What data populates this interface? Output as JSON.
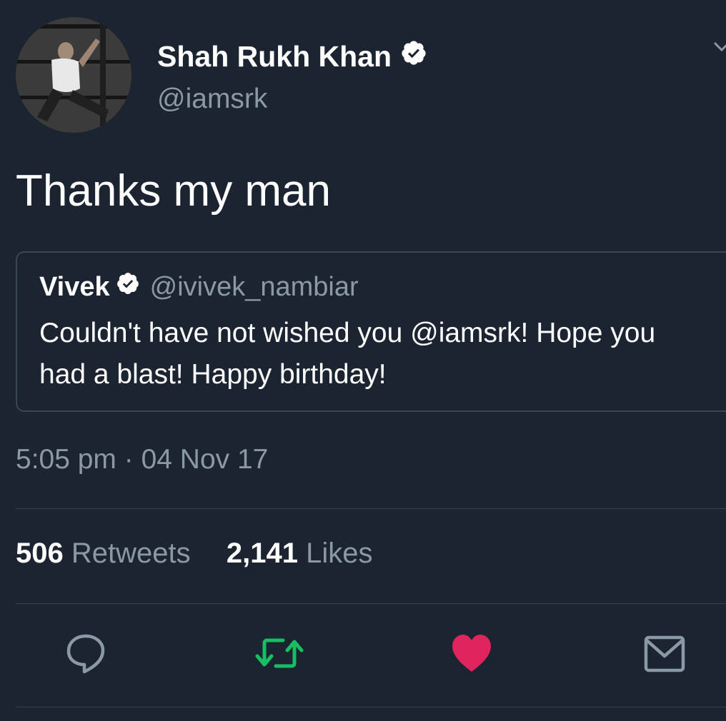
{
  "tweet": {
    "author": {
      "name": "Shah Rukh Khan",
      "handle": "@iamsrk",
      "verified": true,
      "avatar_icon": "profile-photo"
    },
    "text": "Thanks my man",
    "quoted_tweet": {
      "author_name": "Vivek",
      "author_handle": "@ivivek_nambiar",
      "verified": true,
      "text": "Couldn't have not wished you @iamsrk! Hope you had a blast! Happy birthday!"
    },
    "timestamp": "5:05 pm · 04 Nov 17",
    "stats": {
      "retweets_count": "506",
      "retweets_label": "Retweets",
      "likes_count": "2,141",
      "likes_label": "Likes"
    },
    "actions": [
      {
        "icon": "reply-icon",
        "color": "#8b98a5"
      },
      {
        "icon": "retweet-icon",
        "color": "#17bf63",
        "active": true
      },
      {
        "icon": "heart-icon",
        "color": "#e0245e",
        "active": true
      },
      {
        "icon": "direct-message-icon",
        "color": "#8b98a5"
      }
    ]
  },
  "colors": {
    "background": "#1b2430",
    "secondary_text": "#8b98a5",
    "retweet_active": "#17bf63",
    "like_active": "#e0245e"
  }
}
